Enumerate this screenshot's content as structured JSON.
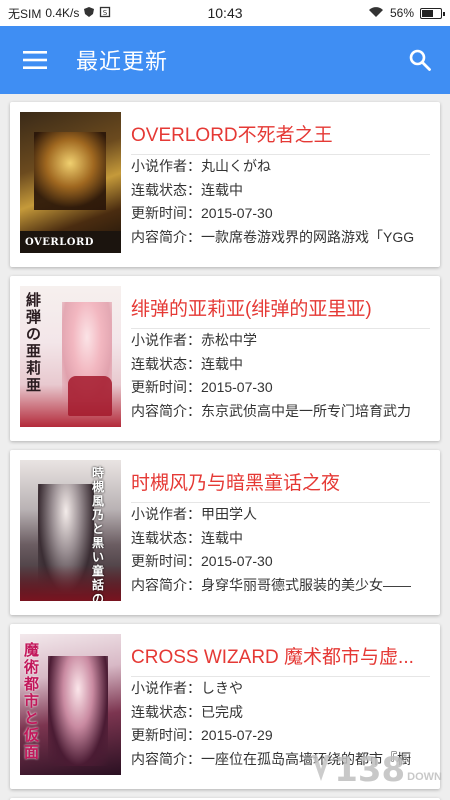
{
  "status_bar": {
    "carrier": "无SIM",
    "speed": "0.4K/s",
    "time": "10:43",
    "battery": "56%",
    "battery_level": 0.56
  },
  "app_bar": {
    "title": "最近更新",
    "menu_icon": "hamburger-menu-icon",
    "search_icon": "search-icon"
  },
  "books": [
    {
      "title": "OVERLORD不死者之王",
      "author_label": "小说作者：",
      "author": "丸山くがね",
      "status_label": "连载状态：",
      "status": "连载中",
      "updated_label": "更新时间：",
      "updated": "2015-07-30",
      "summary_label": "内容简介：",
      "summary": "一款席卷游戏界的网路游戏「YGG",
      "cover_text": "OVERLORD"
    },
    {
      "title": "绯弹的亚莉亚(绯弹的亚里亚)",
      "author_label": "小说作者：",
      "author": "赤松中学",
      "status_label": "连载状态：",
      "status": "连载中",
      "updated_label": "更新时间：",
      "updated": "2015-07-30",
      "summary_label": "内容简介：",
      "summary": "东京武侦高中是一所专门培育武力",
      "cover_text": "緋弾の亜莉亜"
    },
    {
      "title": "时槻风乃与暗黑童话之夜",
      "author_label": "小说作者：",
      "author": "甲田学人",
      "status_label": "连载状态：",
      "status": "连载中",
      "updated_label": "更新时间：",
      "updated": "2015-07-30",
      "summary_label": "内容简介：",
      "summary": "身穿华丽哥德式服装的美少女——",
      "cover_text": "時槻風乃と黒い童話の夜"
    },
    {
      "title": "CROSS WIZARD 魔术都市与虚...",
      "author_label": "小说作者：",
      "author": "しきや",
      "status_label": "连载状态：",
      "status": "已完成",
      "updated_label": "更新时间：",
      "updated": "2015-07-29",
      "summary_label": "内容简介：",
      "summary": "一座位在孤岛高墙环绕的都市『橱",
      "cover_text": "魔術都市と仮面"
    }
  ],
  "watermark": {
    "number": "138",
    "suffix": "DOWN"
  },
  "colors": {
    "app_bar": "#3f8ef3",
    "title_red": "#e53935"
  }
}
